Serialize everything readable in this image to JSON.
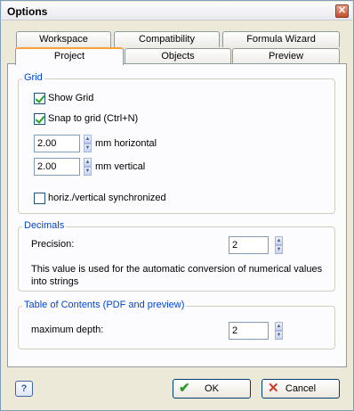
{
  "window": {
    "title": "Options",
    "close_glyph": "✕"
  },
  "tabs": {
    "row1": [
      {
        "label": "Workspace"
      },
      {
        "label": "Compatibility"
      },
      {
        "label": "Formula Wizard"
      }
    ],
    "row2": [
      {
        "label": "Project",
        "active": true
      },
      {
        "label": "Objects"
      },
      {
        "label": "Preview"
      }
    ]
  },
  "grid": {
    "legend": "Grid",
    "show_grid": {
      "label": "Show Grid",
      "checked": true
    },
    "snap_to_grid": {
      "label": "Snap to grid (Ctrl+N)",
      "checked": true
    },
    "horizontal": {
      "value": "2.00",
      "unit_label": "mm horizontal"
    },
    "vertical": {
      "value": "2.00",
      "unit_label": "mm vertical"
    },
    "synchronized": {
      "label": "horiz./vertical synchronized",
      "checked": false
    }
  },
  "decimals": {
    "legend": "Decimals",
    "precision_label": "Precision:",
    "precision_value": "2",
    "note": "This value is used for the automatic conversion of numerical values into strings"
  },
  "toc": {
    "legend": "Table of Contents (PDF and preview)",
    "depth_label": "maximum depth:",
    "depth_value": "2"
  },
  "buttons": {
    "help": "?",
    "ok": "OK",
    "cancel": "Cancel",
    "ok_icon": "checkmark-icon",
    "cancel_icon": "x-icon"
  },
  "colors": {
    "accent": "#f7a23b",
    "legend": "#0046d5",
    "check": "#21a121"
  }
}
